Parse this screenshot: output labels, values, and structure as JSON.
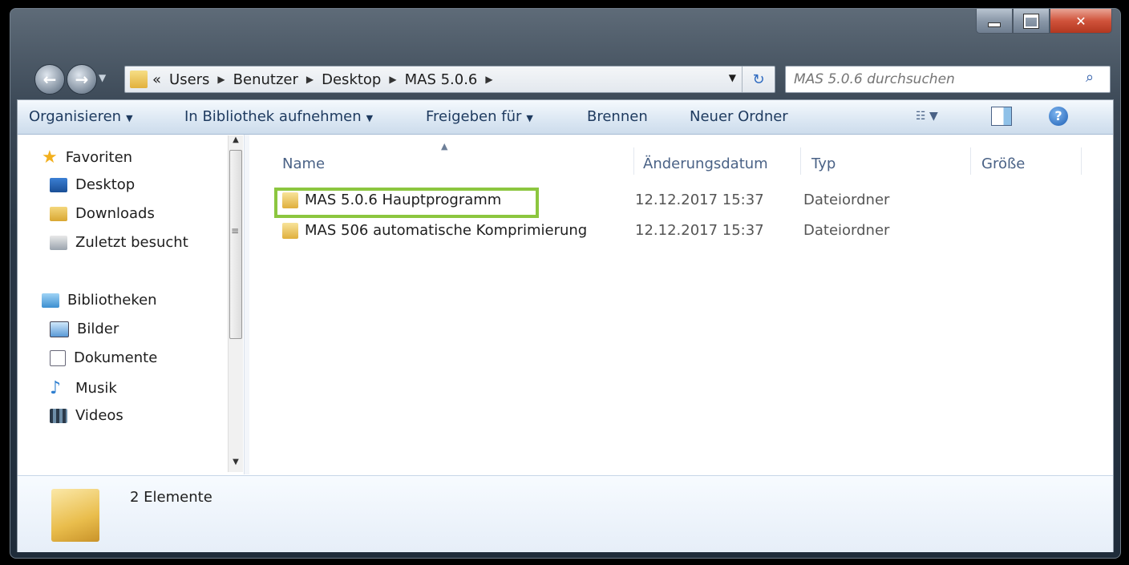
{
  "breadcrumb": {
    "overflow": "«",
    "items": [
      "Users",
      "Benutzer",
      "Desktop",
      "MAS 5.0.6"
    ]
  },
  "search": {
    "placeholder": "MAS 5.0.6 durchsuchen"
  },
  "toolbar": {
    "organize": "Organisieren",
    "library": "In Bibliothek aufnehmen",
    "share": "Freigeben für",
    "burn": "Brennen",
    "new_folder": "Neuer Ordner"
  },
  "nav": {
    "favorites": "Favoriten",
    "desktop": "Desktop",
    "downloads": "Downloads",
    "recent": "Zuletzt besucht",
    "libraries": "Bibliotheken",
    "pictures": "Bilder",
    "documents": "Dokumente",
    "music": "Musik",
    "videos": "Videos"
  },
  "columns": {
    "name": "Name",
    "date": "Änderungsdatum",
    "type": "Typ",
    "size": "Größe"
  },
  "files": [
    {
      "name": "MAS 5.0.6 Hauptprogramm",
      "date": "12.12.2017 15:37",
      "type": "Dateiordner"
    },
    {
      "name": "MAS 506 automatische Komprimierung",
      "date": "12.12.2017 15:37",
      "type": "Dateiordner"
    }
  ],
  "status": {
    "count": "2 Elemente"
  },
  "colors": {
    "highlight": "#8cc63f",
    "toolbar_text": "#1e3a5f"
  }
}
